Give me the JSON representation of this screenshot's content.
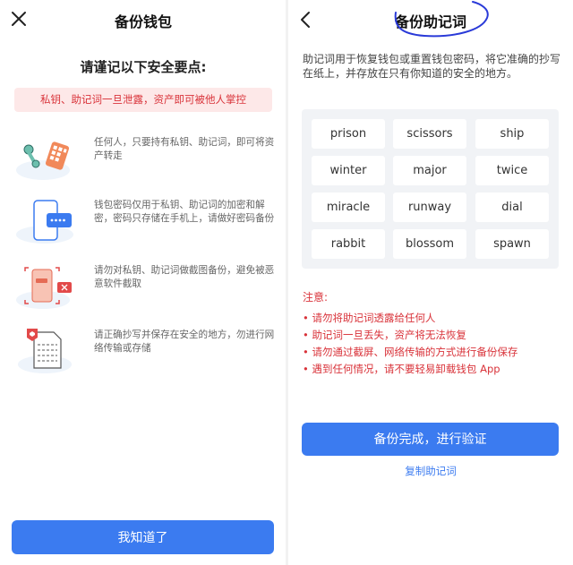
{
  "left": {
    "title": "备份钱包",
    "heading": "请谨记以下安全要点:",
    "warning": "私钥、助记词一旦泄露，资产即可被他人掌控",
    "tips": [
      {
        "icon": "keys-illustration-icon",
        "text": "任何人，只要持有私钥、助记词，即可将资产转走"
      },
      {
        "icon": "phone-password-illustration-icon",
        "text": "钱包密码仅用于私钥、助记词的加密和解密，密码只存储在手机上，请做好密码备份"
      },
      {
        "icon": "no-screenshot-illustration-icon",
        "text": "请勿对私钥、助记词做截图备份，避免被恶意软件截取"
      },
      {
        "icon": "document-illustration-icon",
        "text": "请正确抄写并保存在安全的地方，勿进行网络传输或存储"
      }
    ],
    "ok_button": "我知道了"
  },
  "right": {
    "title": "备份助记词",
    "description": "助记词用于恢复钱包或重置钱包密码，将它准确的抄写在纸上，并存放在只有你知道的安全的地方。",
    "words": [
      "prison",
      "scissors",
      "ship",
      "winter",
      "major",
      "twice",
      "miracle",
      "runway",
      "dial",
      "rabbit",
      "blossom",
      "spawn"
    ],
    "notice_title": "注意:",
    "notices": [
      "• 请勿将助记词透露给任何人",
      "• 助记词一旦丢失，资产将无法恢复",
      "• 请勿通过截屏、网络传输的方式进行备份保存",
      "• 遇到任何情况，请不要轻易卸载钱包 App"
    ],
    "verify_button": "备份完成，进行验证",
    "copy_link": "复制助记词"
  },
  "colors": {
    "accent": "#3b7bf0",
    "danger": "#d9333a",
    "warning_bg": "#fde8e8",
    "words_bg": "#f1f3f6"
  }
}
